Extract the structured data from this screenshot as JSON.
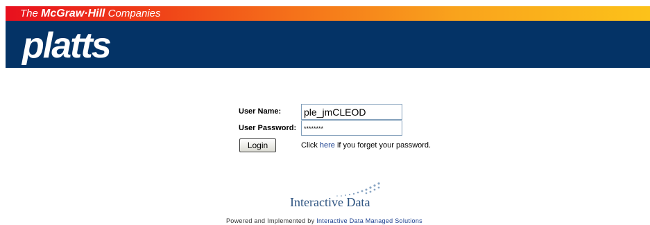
{
  "header": {
    "corporate_prefix": "The ",
    "corporate_name": "McGraw·Hill",
    "corporate_suffix": " Companies",
    "brand_logo": "platts",
    "gradient_colors": [
      "#e8101e",
      "#f5721a",
      "#fcc21a"
    ],
    "band_color": "#043366"
  },
  "login": {
    "username_label": "User Name:",
    "username_value": "ple_jmCLEOD",
    "password_label": "User Password:",
    "password_value": "********",
    "login_button": "Login",
    "forgot_prefix": "Click ",
    "forgot_link": "here",
    "forgot_suffix": " if you forget your password."
  },
  "partner": {
    "logo_text": "Interactive Data",
    "logo_icon": "dots-icon",
    "logo_color": "#2e5481"
  },
  "footer": {
    "prefix": "Powered and Implemented by ",
    "link": "Interactive Data Managed Solutions"
  }
}
